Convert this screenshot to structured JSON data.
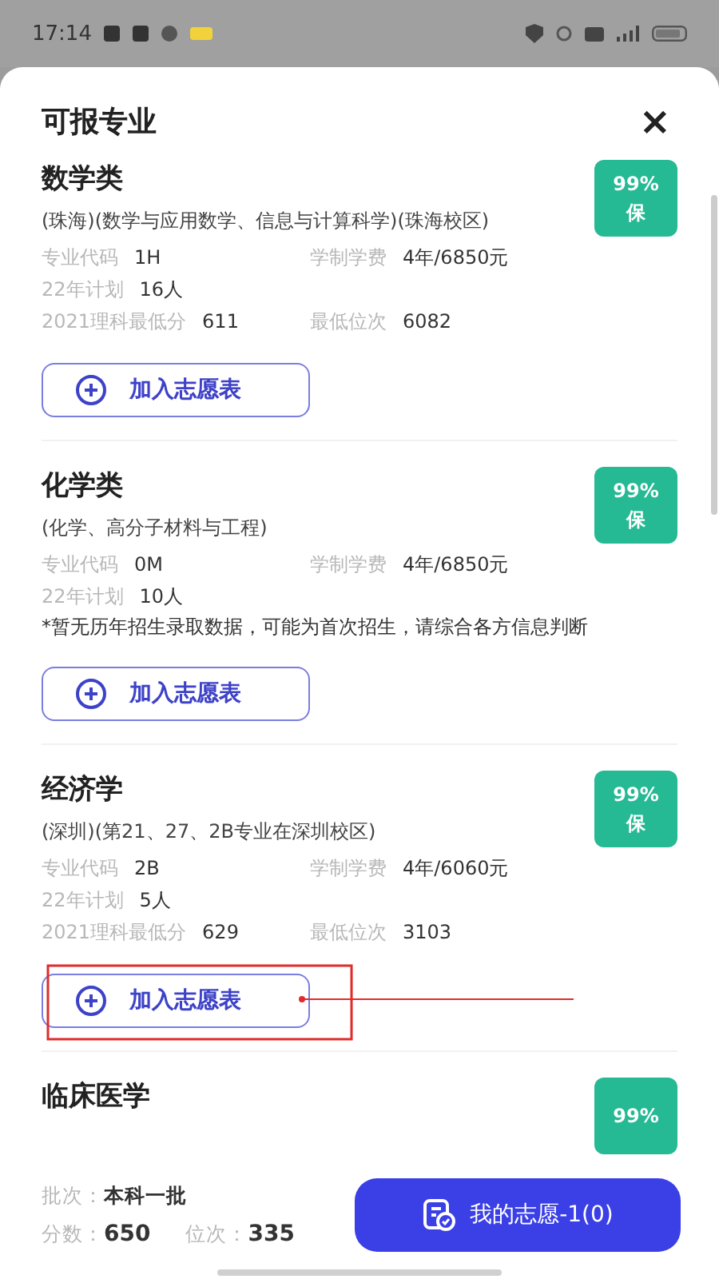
{
  "status_bar": {
    "time": "17:14"
  },
  "sheet": {
    "title": "可报专业",
    "close": "×"
  },
  "majors": [
    {
      "name": "数学类",
      "subtitle": "(珠海)(数学与应用数学、信息与计算科学)(珠海校区)",
      "badge": {
        "percent": "99%",
        "label": "保"
      },
      "rows": [
        [
          {
            "label": "专业代码",
            "value": "1H"
          },
          {
            "label": "学制学费",
            "value": "4年/6850元"
          }
        ],
        [
          {
            "label": "22年计划",
            "value": "16人"
          }
        ],
        [
          {
            "label": "2021理科最低分",
            "value": "611"
          },
          {
            "label": "最低位次",
            "value": "6082"
          }
        ]
      ],
      "button": {
        "label": "加入志愿表",
        "annotated": false
      }
    },
    {
      "name": "化学类",
      "subtitle": "(化学、高分子材料与工程)",
      "badge": {
        "percent": "99%",
        "label": "保"
      },
      "rows": [
        [
          {
            "label": "专业代码",
            "value": "0M"
          },
          {
            "label": "学制学费",
            "value": "4年/6850元"
          }
        ],
        [
          {
            "label": "22年计划",
            "value": "10人"
          }
        ]
      ],
      "note": "*暂无历年招生录取数据，可能为首次招生，请综合各方信息判断",
      "button": {
        "label": "加入志愿表",
        "annotated": false
      }
    },
    {
      "name": "经济学",
      "subtitle": "(深圳)(第21、27、2B专业在深圳校区)",
      "badge": {
        "percent": "99%",
        "label": "保"
      },
      "rows": [
        [
          {
            "label": "专业代码",
            "value": "2B"
          },
          {
            "label": "学制学费",
            "value": "4年/6060元"
          }
        ],
        [
          {
            "label": "22年计划",
            "value": "5人"
          }
        ],
        [
          {
            "label": "2021理科最低分",
            "value": "629"
          },
          {
            "label": "最低位次",
            "value": "3103"
          }
        ]
      ],
      "button": {
        "label": "加入志愿表",
        "annotated": true
      }
    },
    {
      "name": "临床医学",
      "badge": {
        "percent": "99%"
      }
    }
  ],
  "footer": {
    "batch_label": "批次：",
    "batch": "本科一批",
    "score_label": "分数：",
    "score": "650",
    "rank_label": "位次：",
    "rank": "335",
    "button": "我的志愿-1(0)"
  }
}
